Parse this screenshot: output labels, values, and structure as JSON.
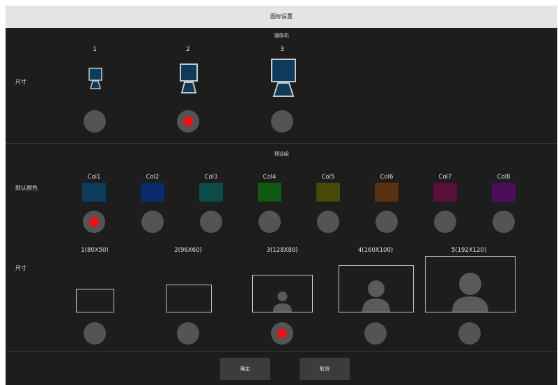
{
  "window": {
    "title": "图标设置"
  },
  "camera_section": {
    "title": "摄像机",
    "size_label": "尺寸",
    "sizes": [
      {
        "label": "1",
        "selected": false
      },
      {
        "label": "2",
        "selected": true
      },
      {
        "label": "3",
        "selected": false
      }
    ]
  },
  "preset_section": {
    "title": "预设组",
    "color_label": "默认颜色",
    "colors": [
      {
        "label": "Col1",
        "color": "#0d3c5e",
        "selected": true
      },
      {
        "label": "Col2",
        "color": "#0b2a6b",
        "selected": false
      },
      {
        "label": "Col3",
        "color": "#0d4a4a",
        "selected": false
      },
      {
        "label": "Col4",
        "color": "#0e5a12",
        "selected": false
      },
      {
        "label": "Col5",
        "color": "#4a4a06",
        "selected": false
      },
      {
        "label": "Col6",
        "color": "#5a3212",
        "selected": false
      },
      {
        "label": "Col7",
        "color": "#5a0e3a",
        "selected": false
      },
      {
        "label": "Col8",
        "color": "#4a0e5a",
        "selected": false
      }
    ],
    "size_label": "尺寸",
    "sizes": [
      {
        "label": "1(80X50)",
        "selected": false
      },
      {
        "label": "2(96X60)",
        "selected": false
      },
      {
        "label": "3(128X80)",
        "selected": true
      },
      {
        "label": "4(160X100)",
        "selected": false
      },
      {
        "label": "5(192X120)",
        "selected": false
      }
    ]
  },
  "footer": {
    "ok_label": "确定",
    "cancel_label": "取消"
  },
  "colors": {
    "accent_red": "#f01010",
    "camera_fill": "#0e3a5c",
    "radio_gray": "#545454"
  }
}
